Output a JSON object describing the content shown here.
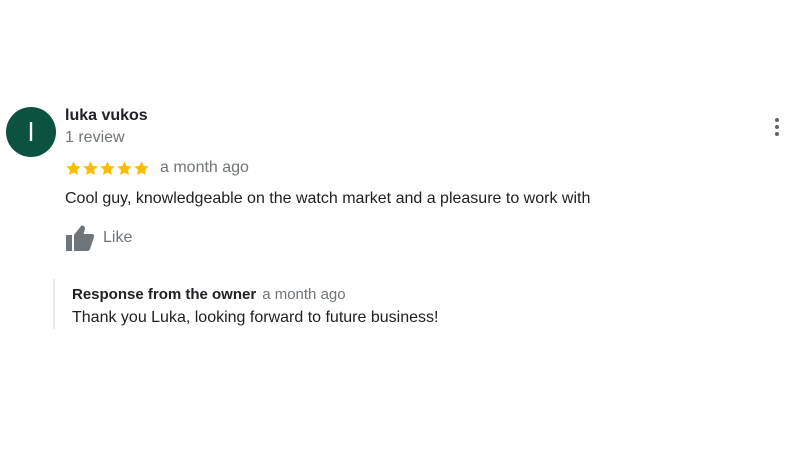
{
  "review": {
    "author": {
      "initial": "l",
      "name": "luka vukos",
      "review_count": "1 review",
      "avatar_color": "#0b5340"
    },
    "rating": 5,
    "star_color": "#fbbc04",
    "date": "a month ago",
    "text": "Cool guy, knowledgeable on the watch market and a pleasure to work with",
    "like_label": "Like",
    "more_icon": "more-vert-icon"
  },
  "owner_response": {
    "title": "Response from the owner",
    "date": "a month ago",
    "text": "Thank you Luka, looking forward to future business!"
  }
}
